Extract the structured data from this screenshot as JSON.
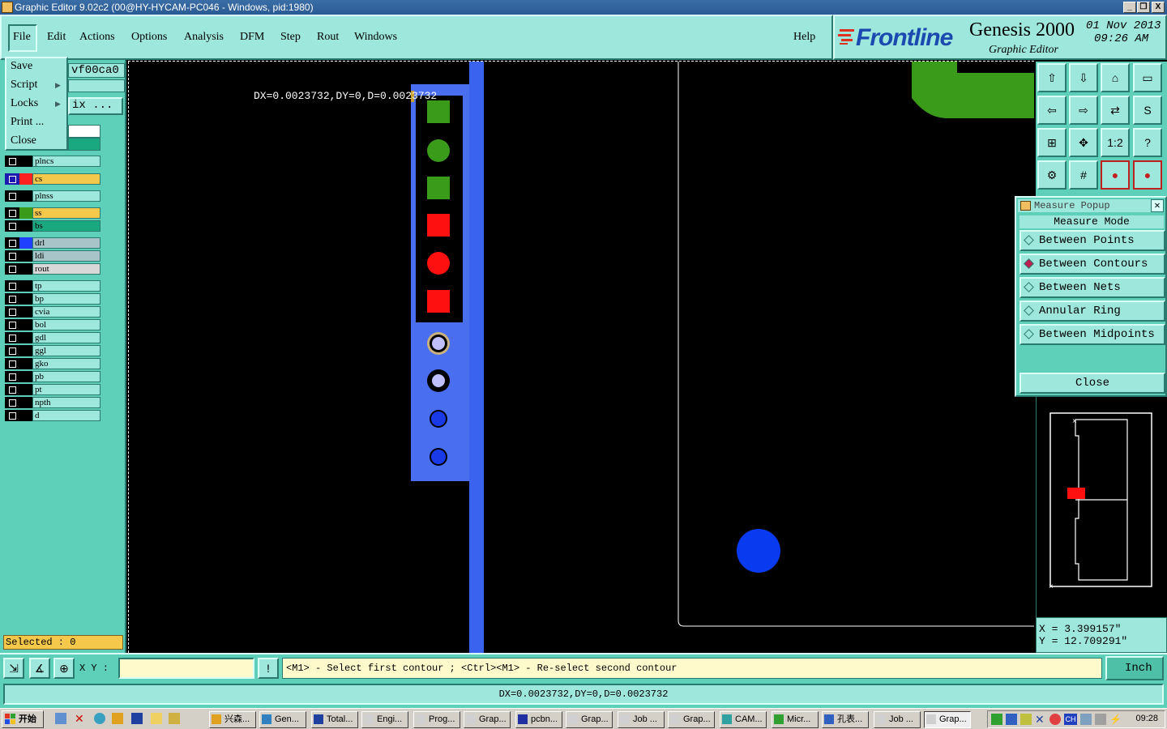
{
  "window": {
    "title": "Graphic Editor 9.02c2 (00@HY-HYCAM-PC046 - Windows, pid:1980)",
    "buttons": [
      "_",
      "❐",
      "X"
    ]
  },
  "menubar": {
    "items": [
      "File",
      "Edit",
      "Actions",
      "Options",
      "Analysis",
      "DFM",
      "Step",
      "Rout",
      "Windows"
    ],
    "help": "Help"
  },
  "logo": {
    "brand": "Frontline",
    "product": "Genesis 2000",
    "subtitle": "Graphic Editor",
    "date": "01 Nov 2013",
    "time": "09:26 AM"
  },
  "file_menu": {
    "items": [
      {
        "label": "Save",
        "submenu": false
      },
      {
        "label": "Script",
        "submenu": true
      },
      {
        "label": "Locks",
        "submenu": true
      },
      {
        "label": "Print ...",
        "submenu": false
      },
      {
        "label": "Close",
        "submenu": false
      }
    ]
  },
  "left_panel": {
    "step_name": "vf00ca0",
    "matrix_button": "ix ...",
    "selected": "Selected : 0",
    "layers": [
      {
        "name": "plncs",
        "color": "#000000",
        "bg": "#9ee7dc"
      },
      {
        "name": "cs",
        "color": "#ff2020",
        "bg": "#f4c84a",
        "active": true
      },
      {
        "name": "plnss",
        "color": "#000000",
        "bg": "#9ee7dc"
      },
      {
        "name": "ss",
        "color": "#3a9a1a",
        "bg": "#f4c84a"
      },
      {
        "name": "bs",
        "color": "#000000",
        "bg": "#1aa880"
      },
      {
        "name": "drl",
        "color": "#2040ff",
        "bg": "#a8c4c8"
      },
      {
        "name": "ldi",
        "color": "#000000",
        "bg": "#a8c4c8"
      },
      {
        "name": "rout",
        "color": "#000000",
        "bg": "#d8d8d8"
      },
      {
        "name": "tp",
        "color": "#000000",
        "bg": "#9ee7dc"
      },
      {
        "name": "bp",
        "color": "#000000",
        "bg": "#9ee7dc"
      },
      {
        "name": "cvia",
        "color": "#000000",
        "bg": "#9ee7dc"
      },
      {
        "name": "bol",
        "color": "#000000",
        "bg": "#9ee7dc"
      },
      {
        "name": "gdl",
        "color": "#000000",
        "bg": "#9ee7dc"
      },
      {
        "name": "ggl",
        "color": "#000000",
        "bg": "#9ee7dc"
      },
      {
        "name": "gko",
        "color": "#000000",
        "bg": "#9ee7dc"
      },
      {
        "name": "pb",
        "color": "#000000",
        "bg": "#9ee7dc"
      },
      {
        "name": "pt",
        "color": "#000000",
        "bg": "#9ee7dc"
      },
      {
        "name": "npth",
        "color": "#000000",
        "bg": "#9ee7dc"
      },
      {
        "name": "d",
        "color": "#000000",
        "bg": "#9ee7dc"
      }
    ]
  },
  "canvas": {
    "measure_text": "DX=0.0023732,DY=0,D=0.0023732"
  },
  "right_tools": {
    "buttons": [
      "zoom-home",
      "zoom-fit",
      "home",
      "panel",
      "pan-left",
      "pan-right",
      "mirror",
      "snap",
      "fit-screen",
      "center",
      "1:2",
      "?",
      "settings",
      "grid",
      "layers-red",
      "layers-red-2"
    ],
    "labels": {
      "ratio": "1:2",
      "help": "?"
    }
  },
  "measure_popup": {
    "title": "Measure Popup",
    "header": "Measure Mode",
    "options": [
      {
        "label": "Between Points",
        "selected": false
      },
      {
        "label": "Between Contours",
        "selected": true
      },
      {
        "label": "Between Nets",
        "selected": false
      },
      {
        "label": "Annular Ring",
        "selected": false
      },
      {
        "label": "Between Midpoints",
        "selected": false
      }
    ],
    "close": "Close"
  },
  "coords": {
    "x": "X = 3.399157\"",
    "y": "Y = 12.709291\""
  },
  "command_bar": {
    "xy_label": "X Y :",
    "xy_value": "",
    "info_button": "!",
    "hint": "<M1> - Select first contour ; <Ctrl><M1> - Re-select second contour",
    "unit": "Inch"
  },
  "status": {
    "text": "DX=0.0023732,DY=0,D=0.0023732"
  },
  "taskbar": {
    "start": "开始",
    "tasks": [
      {
        "label": "兴森..."
      },
      {
        "label": "Gen..."
      },
      {
        "label": "Total..."
      },
      {
        "label": "Engi..."
      },
      {
        "label": "Prog..."
      },
      {
        "label": "Grap..."
      },
      {
        "label": "pcbn..."
      },
      {
        "label": "Grap..."
      },
      {
        "label": "Job ..."
      },
      {
        "label": "Grap..."
      },
      {
        "label": "CAM..."
      },
      {
        "label": "Micr..."
      },
      {
        "label": "孔表..."
      },
      {
        "label": "Job ..."
      },
      {
        "label": "Grap...",
        "active": true
      }
    ],
    "tray_lang": "CH",
    "clock": "09:28"
  }
}
